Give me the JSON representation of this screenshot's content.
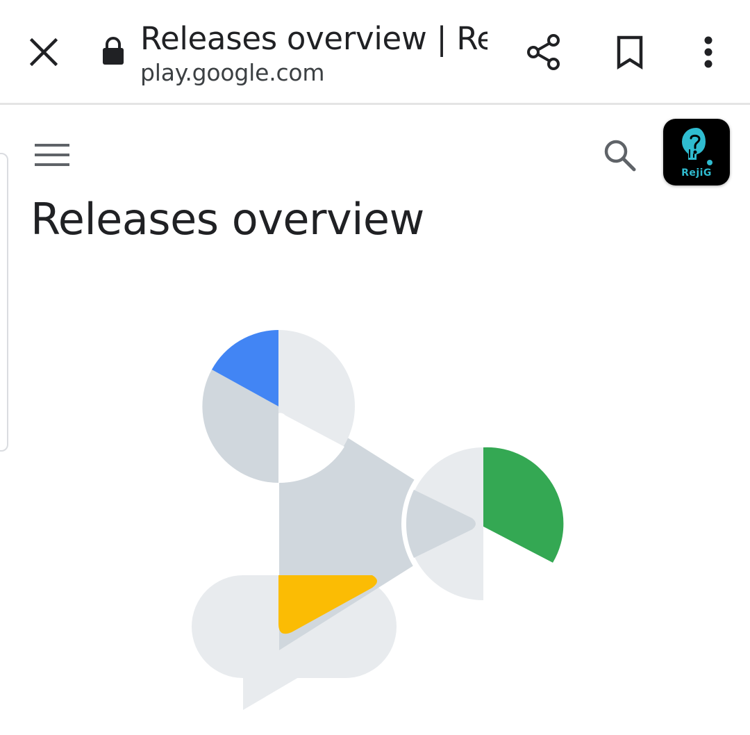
{
  "toolbar": {
    "title": "Releases overview | Re...",
    "url": "play.google.com",
    "icons": {
      "close": "close-icon",
      "lock": "lock-icon",
      "share": "share-icon",
      "bookmark": "bookmark-icon",
      "more": "more-vert-icon"
    }
  },
  "header": {
    "menu_icon": "menu-icon",
    "search_icon": "search-icon",
    "app_icon_label": "RejiG"
  },
  "main": {
    "title": "Releases overview"
  },
  "colors": {
    "blue": "#4285f4",
    "green": "#34a853",
    "yellow": "#fbbc04",
    "light_gray": "#e8ebee",
    "mid_gray": "#d0d7dd",
    "app_icon_teal": "#2fbcd0"
  }
}
